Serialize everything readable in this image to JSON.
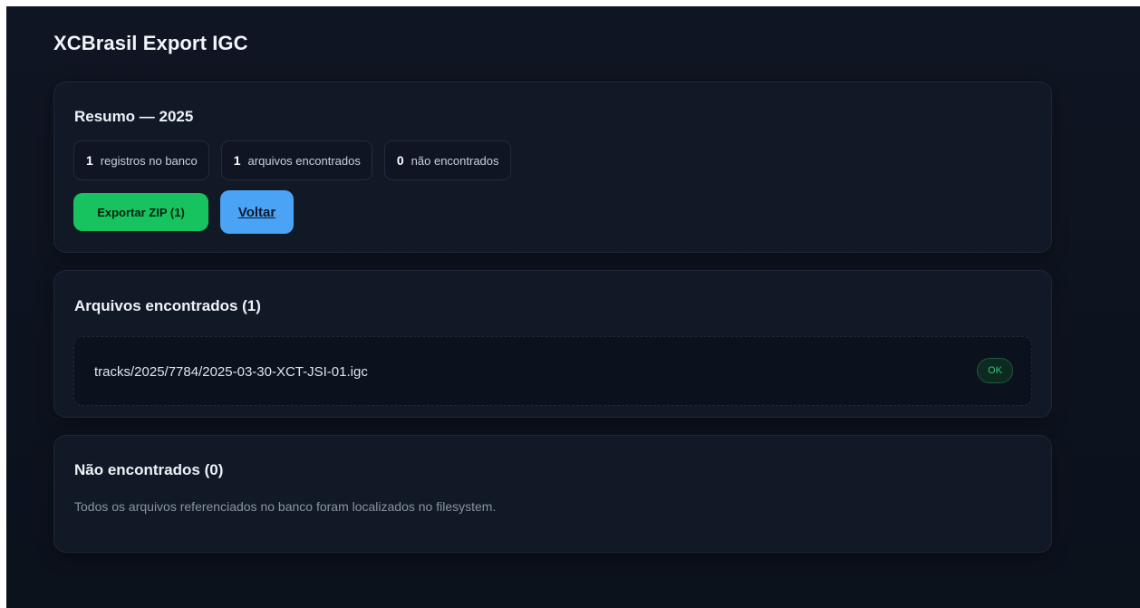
{
  "header": {
    "title": "XCBrasil Export IGC"
  },
  "summary": {
    "title": "Resumo — 2025",
    "stats": [
      {
        "value": "1",
        "label": "registros no banco"
      },
      {
        "value": "1",
        "label": "arquivos encontrados"
      },
      {
        "value": "0",
        "label": "não encontrados"
      }
    ],
    "export_button": "Exportar ZIP (1)",
    "back_button": "Voltar"
  },
  "found": {
    "title": "Arquivos encontrados (1)",
    "files": [
      {
        "path": "tracks/2025/7784/2025-03-30-XCT-JSI-01.igc",
        "status": "OK"
      }
    ]
  },
  "missing": {
    "title": "Não encontrados (0)",
    "message": "Todos os arquivos referenciados no banco foram localizados no filesystem."
  },
  "colors": {
    "background": "#0f1522",
    "card": "#121926",
    "export_button": "#17c35e",
    "back_button": "#4ba3f5",
    "ok_badge": "#2fc27a"
  }
}
